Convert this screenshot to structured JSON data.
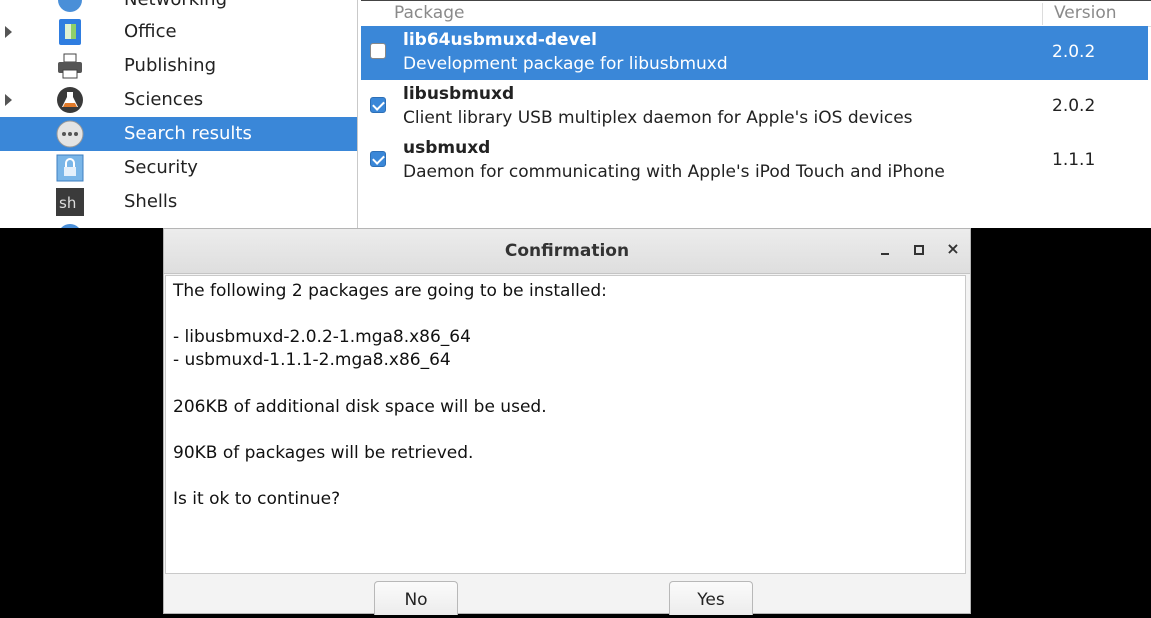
{
  "sidebar": {
    "partial_top_label": "Networking",
    "items": [
      {
        "label": "Office",
        "icon": "office-icon",
        "expandable": true
      },
      {
        "label": "Publishing",
        "icon": "printer-icon",
        "expandable": false
      },
      {
        "label": "Sciences",
        "icon": "flask-icon",
        "expandable": true
      },
      {
        "label": "Search results",
        "icon": "more-icon",
        "expandable": false,
        "selected": true
      },
      {
        "label": "Security",
        "icon": "lock-icon",
        "expandable": false
      },
      {
        "label": "Shells",
        "icon": "terminal-icon",
        "expandable": false,
        "icon_text": "sh"
      }
    ]
  },
  "packages": {
    "columns": {
      "package": "Package",
      "version": "Version"
    },
    "rows": [
      {
        "name": "lib64usbmuxd-devel",
        "description": "Development package for libusbmuxd",
        "version": "2.0.2",
        "checked": false,
        "selected": true
      },
      {
        "name": "libusbmuxd",
        "description": "Client library USB multiplex daemon for Apple's iOS devices",
        "version": "2.0.2",
        "checked": true,
        "selected": false
      },
      {
        "name": "usbmuxd",
        "description": "Daemon for communicating with Apple's iPod Touch and iPhone",
        "version": "1.1.1",
        "checked": true,
        "selected": false
      }
    ]
  },
  "dialog": {
    "title": "Confirmation",
    "message": {
      "intro": "The following 2 packages are going to be installed:",
      "packages": [
        "- libusbmuxd-2.0.2-1.mga8.x86_64",
        "- usbmuxd-1.1.1-2.mga8.x86_64"
      ],
      "disk_space": "206KB of additional disk space will be used.",
      "retrieve": "90KB of packages will be retrieved.",
      "question": "Is it ok to continue?"
    },
    "buttons": {
      "no": "No",
      "yes": "Yes"
    },
    "window_controls": {
      "minimize": "minimize-icon",
      "maximize": "maximize-icon",
      "close": "close-icon",
      "close_glyph": "×"
    }
  },
  "colors": {
    "selection": "#3a87d8",
    "dialog_bg": "#f3f3f3"
  }
}
